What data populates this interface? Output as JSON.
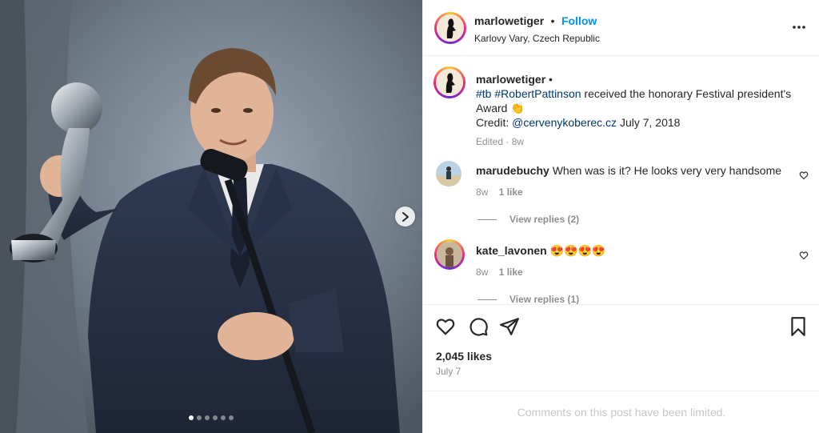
{
  "post": {
    "username": "marlowetiger",
    "follow_label": "Follow",
    "location": "Karlovy Vary, Czech Republic",
    "separator": "•"
  },
  "caption": {
    "username": "marlowetiger",
    "dot": "•",
    "hashtag1": "#tb",
    "hashtag2": "#RobertPattinson",
    "text": " received the honorary Festival president's Award 👏",
    "credit_prefix": "Credit: ",
    "credit_handle": "@cervenykoberec.cz",
    "credit_suffix": " July 7, 2018",
    "edited": "Edited · 8w"
  },
  "comments": [
    {
      "username": "marudebuchy",
      "text": "When was is it? He looks very very handsome",
      "age": "8w",
      "likes": "1 like",
      "replies": "View replies (2)"
    },
    {
      "username": "kate_lavonen",
      "text": "😍😍😍😍",
      "age": "8w",
      "likes": "1 like",
      "replies": "View replies (1)"
    }
  ],
  "stats": {
    "likes": "2,045 likes",
    "date": "July 7"
  },
  "limited_notice": "Comments on this post have been limited.",
  "carousel": {
    "slide_count": 6,
    "active_index": 0
  },
  "icons": {
    "like": "heart-icon",
    "comment": "comment-icon",
    "share": "share-icon",
    "save": "bookmark-icon",
    "more": "more-options-icon",
    "next": "chevron-right-icon"
  },
  "colors": {
    "follow": "#0095f6",
    "link": "#00376b",
    "muted": "#8e8e8e"
  }
}
